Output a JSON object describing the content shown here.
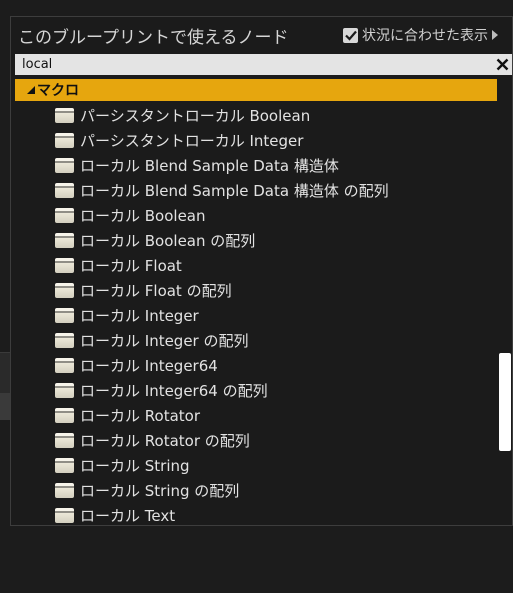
{
  "panel": {
    "title": "このブループリントで使えるノード",
    "context_sensitive": {
      "label": "状況に合わせた表示",
      "checked": true
    }
  },
  "search": {
    "value": "local"
  },
  "category": {
    "label": "マクロ",
    "color": "#E6A60E"
  },
  "items": [
    {
      "label": "パーシスタントローカル Boolean"
    },
    {
      "label": "パーシスタントローカル Integer"
    },
    {
      "label": "ローカル Blend Sample Data 構造体"
    },
    {
      "label": "ローカル Blend Sample Data 構造体 の配列"
    },
    {
      "label": "ローカル Boolean"
    },
    {
      "label": "ローカル Boolean の配列"
    },
    {
      "label": "ローカル Float"
    },
    {
      "label": "ローカル Float の配列"
    },
    {
      "label": "ローカル Integer"
    },
    {
      "label": "ローカル Integer の配列"
    },
    {
      "label": "ローカル Integer64"
    },
    {
      "label": "ローカル Integer64 の配列"
    },
    {
      "label": "ローカル Rotator"
    },
    {
      "label": "ローカル Rotator の配列"
    },
    {
      "label": "ローカル String"
    },
    {
      "label": "ローカル String の配列"
    },
    {
      "label": "ローカル Text"
    }
  ],
  "icons": {
    "macro_node": "macro-node-icon",
    "checkbox": "check-icon",
    "clear": "close-icon",
    "expand": "chevron-right-icon",
    "collapse": "triangle-down-icon"
  }
}
